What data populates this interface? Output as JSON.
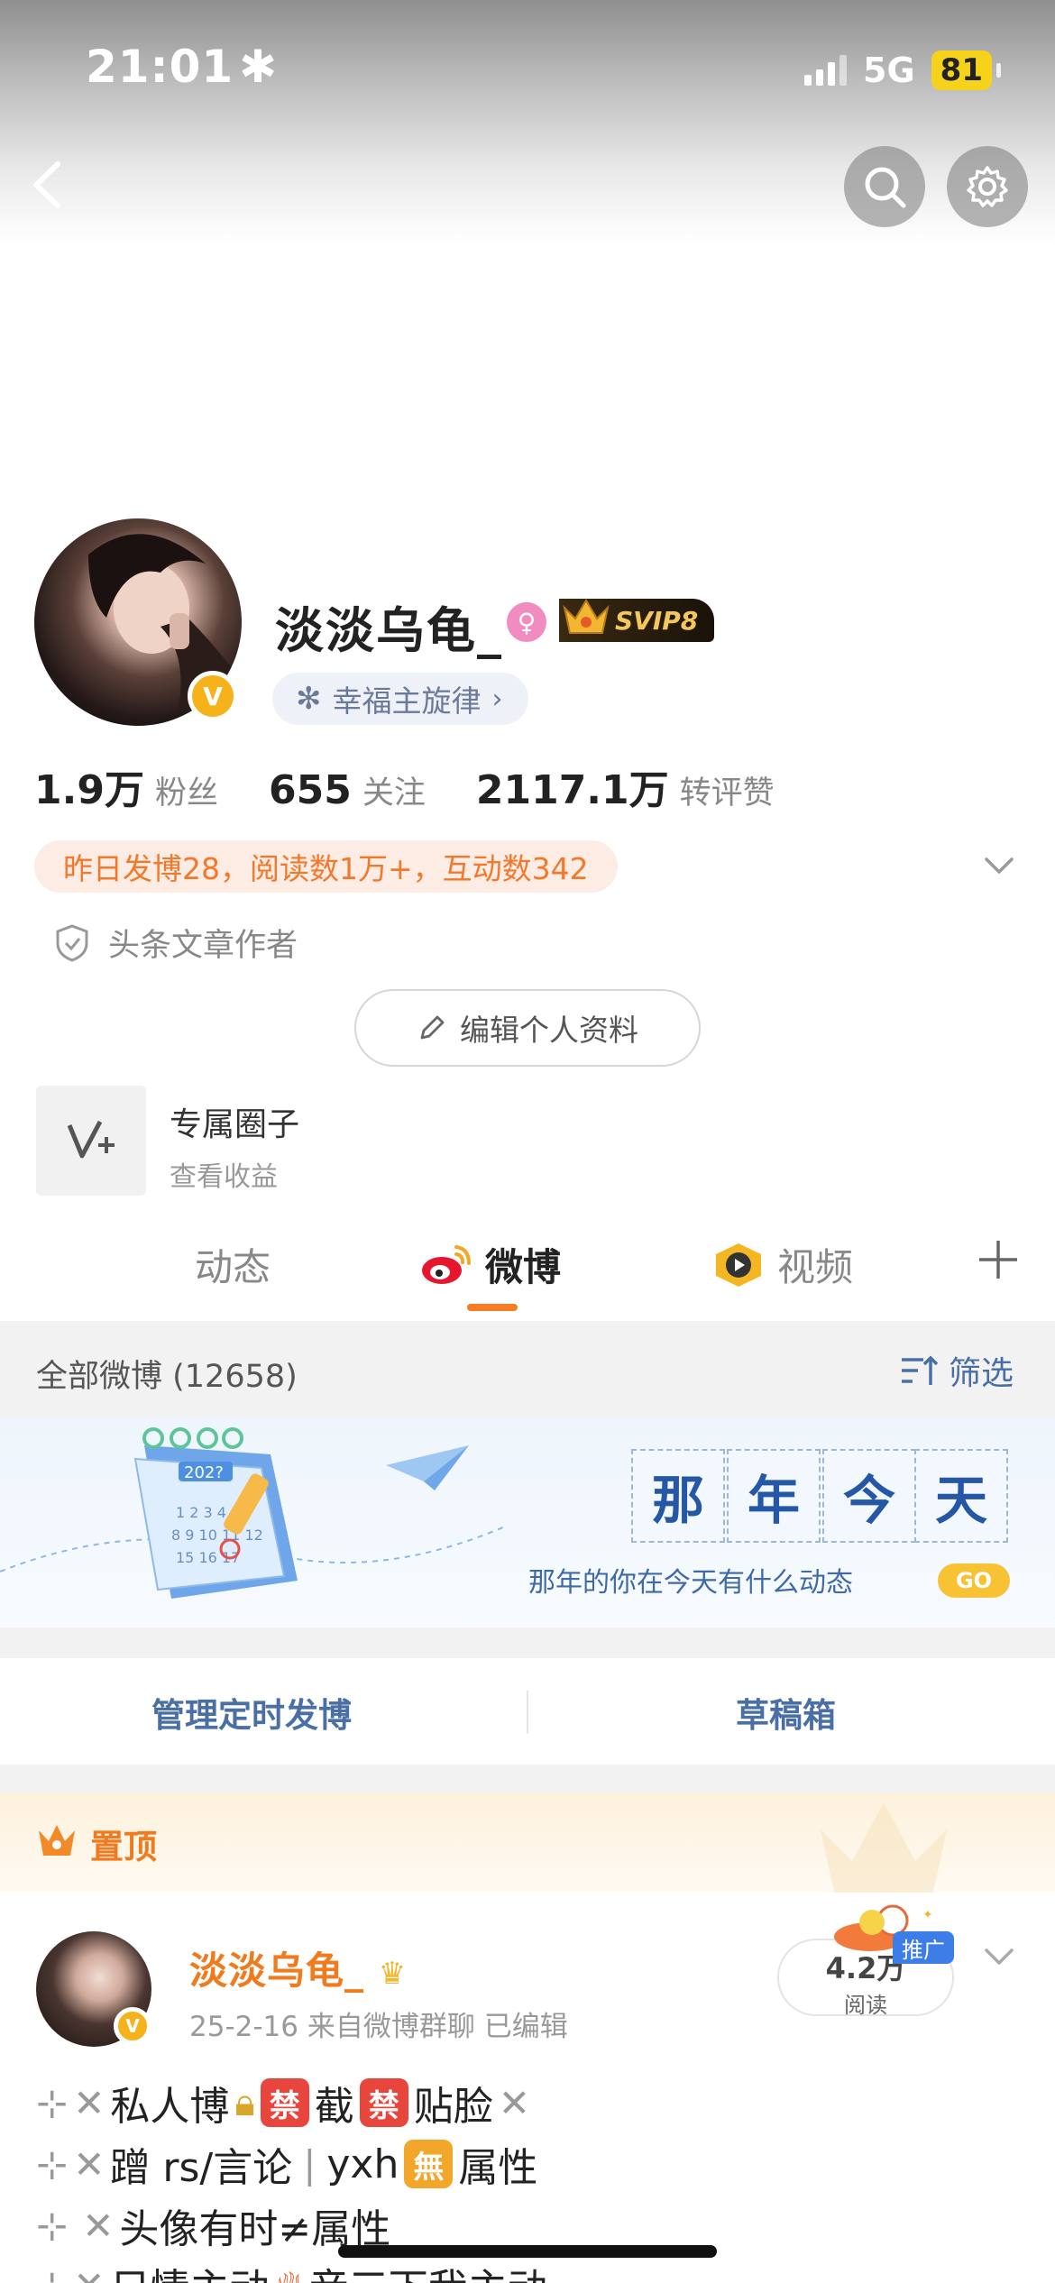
{
  "status_bar": {
    "time": "21:01",
    "network": "5G",
    "battery": "81"
  },
  "profile": {
    "name": "淡淡乌龟_",
    "vip_badge": "SVIP8",
    "music_tag": "幸福主旋律",
    "stats": [
      {
        "num": "1.9万",
        "label": "粉丝"
      },
      {
        "num": "655",
        "label": "关注"
      },
      {
        "num": "2117.1万",
        "label": "转评赞"
      }
    ],
    "activity_summary": "昨日发博28，阅读数1万+，互动数342",
    "author_tag": "头条文章作者",
    "edit_button": "编辑个人资料",
    "circle_title": "专属圈子",
    "circle_subtitle": "查看收益"
  },
  "tabs": [
    {
      "label": "动态"
    },
    {
      "label": "微博"
    },
    {
      "label": "视频"
    }
  ],
  "filter": {
    "label": "全部微博 (12658)",
    "button": "筛选"
  },
  "banner": {
    "chars": [
      "那",
      "年",
      "今",
      "天"
    ],
    "calendar_year": "202?",
    "subtitle": "那年的你在今天有什么动态",
    "go": "GO"
  },
  "actions": {
    "scheduled": "管理定时发博",
    "drafts": "草稿箱"
  },
  "pinned": {
    "label": "置顶",
    "author": "淡淡乌龟_",
    "meta": "25-2-16  来自微博群聊  已编辑",
    "reads_num": "4.2万",
    "reads_label": "阅读",
    "promo": "推广",
    "lines": {
      "l1a": "私人博",
      "ban1": "禁",
      "l1b": "截",
      "ban2": "禁",
      "l1c": "贴脸",
      "l2a": "蹭 rs/言论",
      "l2b": "yxh",
      "wu": "無",
      "l2c": "属性",
      "l3": "头像有时≠属性",
      "l4a": "只情主动",
      "l4b": "音三下我主动"
    }
  },
  "colors": {
    "accent_orange": "#f07b1e",
    "link_blue": "#4a6fa5",
    "vip_gold": "#f6b21a"
  }
}
